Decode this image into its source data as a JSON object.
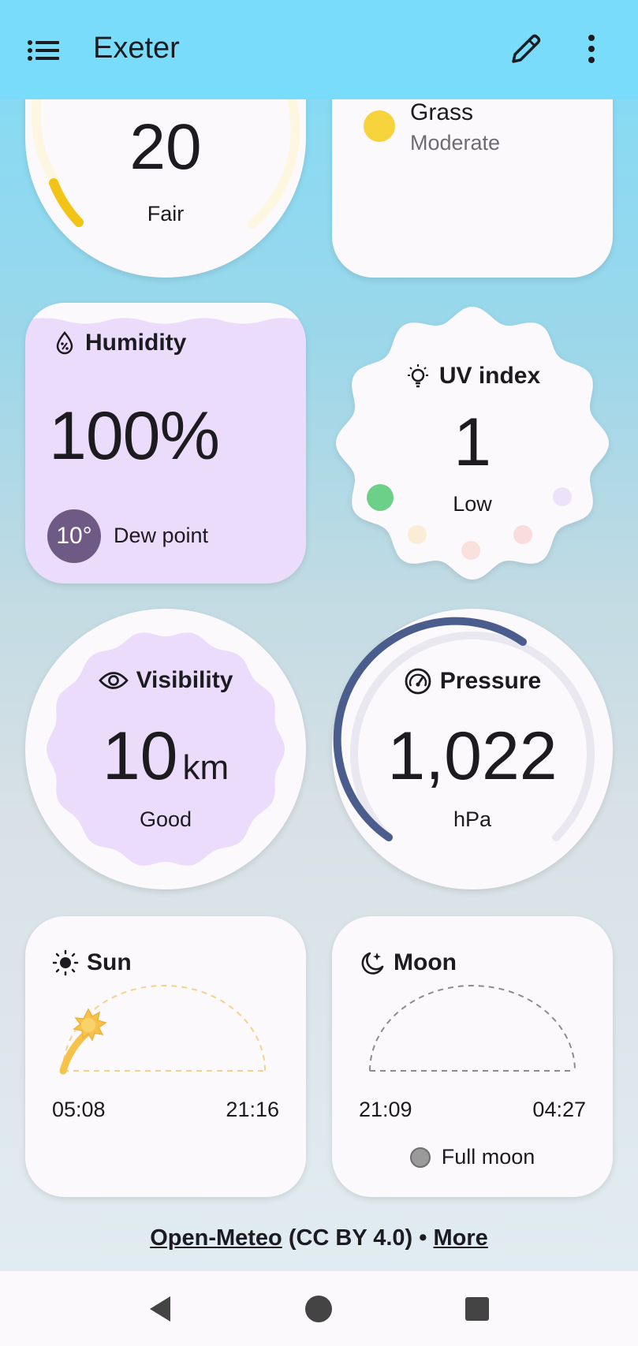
{
  "app_bar": {
    "title": "Exeter",
    "menu_icon": "list-icon",
    "edit_icon": "pencil-icon",
    "more_icon": "more-vert-icon"
  },
  "air_quality": {
    "value": "20",
    "label": "Fair",
    "accent": "#f2c417"
  },
  "pollen": {
    "name": "Grass",
    "level": "Moderate",
    "dot_color": "#f7d33b"
  },
  "humidity": {
    "title": "Humidity",
    "value": "100%",
    "dew_point_value": "10°",
    "dew_point_label": "Dew point",
    "icon": "humidity-icon"
  },
  "uv": {
    "title": "UV index",
    "value": "1",
    "label": "Low",
    "icon": "lightbulb-icon",
    "scale_colors": [
      "#6cd089",
      "#fbe9d0",
      "#f9dede",
      "#f8d9d9",
      "#ece3fa"
    ]
  },
  "visibility": {
    "title": "Visibility",
    "value": "10",
    "unit": "km",
    "label": "Good",
    "icon": "eye-icon"
  },
  "pressure": {
    "title": "Pressure",
    "value": "1,022",
    "unit": "hPa",
    "icon": "gauge-icon",
    "accent": "#4a5d8c"
  },
  "sun": {
    "title": "Sun",
    "sunrise": "05:08",
    "sunset": "21:16",
    "icon": "sun-icon"
  },
  "moon": {
    "title": "Moon",
    "moonrise": "21:09",
    "moonset": "04:27",
    "phase": "Full moon",
    "icon": "moon-icon"
  },
  "attribution": {
    "source_link": "Open-Meteo",
    "license": " (CC BY 4.0) • ",
    "more_link": "More"
  },
  "nav_bar": {
    "back_icon": "back-triangle-icon",
    "home_icon": "home-circle-icon",
    "recents_icon": "recents-square-icon"
  }
}
